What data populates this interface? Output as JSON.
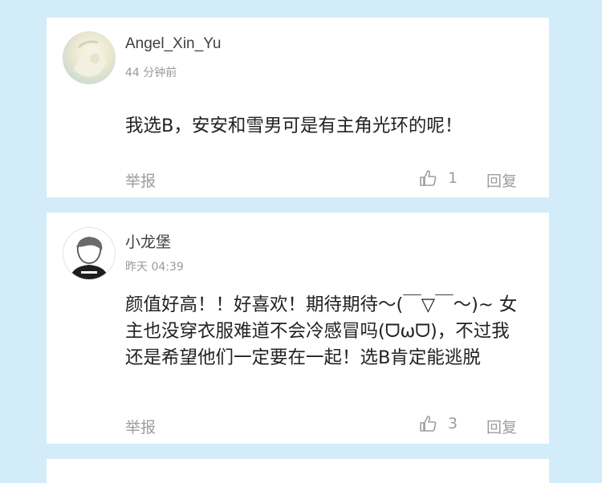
{
  "comments": [
    {
      "username": "Angel_Xin_Yu",
      "time": "44 分钟前",
      "text": "我选B，安安和雪男可是有主角光环的呢！",
      "report_label": "举报",
      "like_count": "1",
      "reply_label": "回复"
    },
    {
      "username": "小龙堡",
      "time": "昨天 04:39",
      "text": "颜值好高！！好喜欢！期待期待～(￣▽￣～)~ 女主也没穿衣服难道不会冷感冒吗(ᗜωᗜ)，不过我还是希望他们一定要在一起！选B肯定能逃脱",
      "report_label": "举报",
      "like_count": "3",
      "reply_label": "回复"
    }
  ],
  "colors": {
    "background": "#d3ecfa",
    "card": "#ffffff",
    "muted": "#9d9d9d"
  },
  "icons": {
    "like": "thumbs-up-icon"
  }
}
